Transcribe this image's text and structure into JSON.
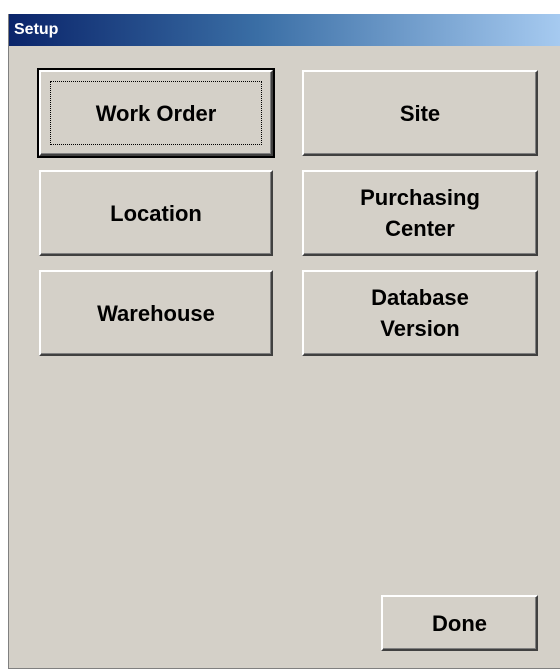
{
  "window": {
    "title": "Setup"
  },
  "buttons": {
    "work_order": "Work Order",
    "site": "Site",
    "location": "Location",
    "purchasing_center": "Purchasing\nCenter",
    "warehouse": "Warehouse",
    "database_version": "Database\nVersion",
    "done": "Done"
  },
  "colors": {
    "titlebar_start": "#0a246a",
    "titlebar_end": "#a6caf0",
    "face": "#d4d0c8"
  }
}
